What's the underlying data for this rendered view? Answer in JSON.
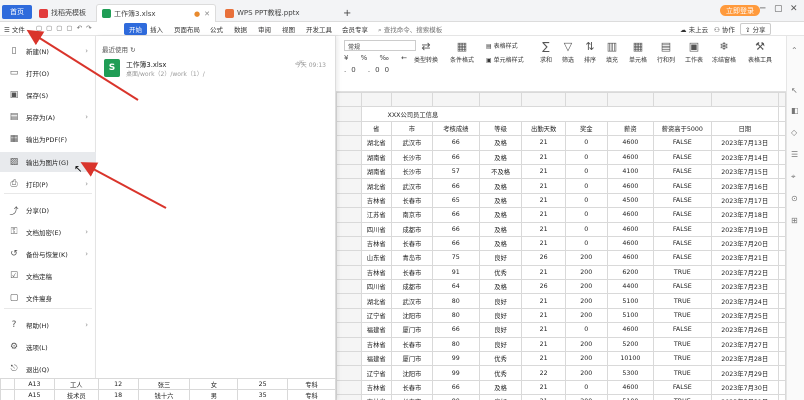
{
  "tabs": {
    "home": "首页",
    "template": "找稻壳模板",
    "xlsx": "工作簿3.xlsx",
    "pptx": "WPS PPT教程.pptx",
    "plus": "+"
  },
  "window": {
    "vip": "立即登录",
    "sync": "未上云",
    "collab": "协作",
    "share": "分享"
  },
  "ribbon": {
    "file": "文件",
    "start": "开始",
    "insert": "插入",
    "layout": "页面布局",
    "formula": "公式",
    "data": "数据",
    "review": "审阅",
    "view": "视图",
    "dev": "开发工具",
    "member": "会员专享",
    "search": "查找命令、搜索模板"
  },
  "toolbar": {
    "font_style": "常规",
    "type_convert": "类型转换",
    "cond_format": "条件格式",
    "table_style": "表格样式",
    "cell_style": "单元格样式",
    "sum": "求和",
    "filter": "筛选",
    "sort": "排序",
    "fill": "填充",
    "cell": "单元格",
    "rowcol": "行和列",
    "sheet": "工作表",
    "freeze": "冻结窗格",
    "table_tools": "表格工具"
  },
  "menu": {
    "items": [
      {
        "label": "新建(N)",
        "icon": "new-icon"
      },
      {
        "label": "打开(O)",
        "icon": "open-icon"
      },
      {
        "label": "保存(S)",
        "icon": "save-icon"
      },
      {
        "label": "另存为(A)",
        "icon": "save-as-icon"
      },
      {
        "label": "输出为PDF(F)",
        "icon": "pdf-icon"
      },
      {
        "label": "输出为图片(G)",
        "icon": "image-icon"
      },
      {
        "label": "打印(P)",
        "icon": "print-icon"
      },
      {
        "label": "分享(D)",
        "icon": "share-icon"
      },
      {
        "label": "文档加密(E)",
        "icon": "lock-icon"
      },
      {
        "label": "备份与恢复(K)",
        "icon": "backup-icon"
      },
      {
        "label": "文档定稿",
        "icon": "finalize-icon"
      },
      {
        "label": "文件瘦身",
        "icon": "slim-icon"
      },
      {
        "label": "帮助(H)",
        "icon": "help-icon"
      },
      {
        "label": "选项(L)",
        "icon": "gear-icon"
      },
      {
        "label": "退出(Q)",
        "icon": "exit-icon"
      }
    ]
  },
  "recent": {
    "title": "最近使用",
    "file_name": "工作簿3.xlsx",
    "file_path": "桌面/work（2）/work（1）/",
    "time": "今天 09:13",
    "file_badge": "S"
  },
  "sheet": {
    "title": "XXX公司员工信息",
    "headers": [
      "省",
      "市",
      "考核成绩",
      "等级",
      "出勤天数",
      "奖金",
      "薪资",
      "薪资高于5000",
      "日期"
    ],
    "rows": [
      [
        "湖北省",
        "武汉市",
        "66",
        "及格",
        "21",
        "0",
        "4600",
        "FALSE",
        "2023年7月13日"
      ],
      [
        "湖南省",
        "长沙市",
        "66",
        "及格",
        "21",
        "0",
        "4600",
        "FALSE",
        "2023年7月14日"
      ],
      [
        "湖南省",
        "长沙市",
        "57",
        "不及格",
        "21",
        "0",
        "4100",
        "FALSE",
        "2023年7月15日"
      ],
      [
        "湖北省",
        "武汉市",
        "66",
        "及格",
        "21",
        "0",
        "4600",
        "FALSE",
        "2023年7月16日"
      ],
      [
        "吉林省",
        "长春市",
        "65",
        "及格",
        "21",
        "0",
        "4500",
        "FALSE",
        "2023年7月17日"
      ],
      [
        "江苏省",
        "南京市",
        "66",
        "及格",
        "21",
        "0",
        "4600",
        "FALSE",
        "2023年7月18日"
      ],
      [
        "四川省",
        "成都市",
        "66",
        "及格",
        "21",
        "0",
        "4600",
        "FALSE",
        "2023年7月19日"
      ],
      [
        "吉林省",
        "长春市",
        "66",
        "及格",
        "21",
        "0",
        "4600",
        "FALSE",
        "2023年7月20日"
      ],
      [
        "山东省",
        "青岛市",
        "75",
        "良好",
        "26",
        "200",
        "4600",
        "FALSE",
        "2023年7月21日"
      ],
      [
        "吉林省",
        "长春市",
        "91",
        "优秀",
        "21",
        "200",
        "6200",
        "TRUE",
        "2023年7月22日"
      ],
      [
        "四川省",
        "成都市",
        "64",
        "及格",
        "26",
        "200",
        "4400",
        "FALSE",
        "2023年7月23日"
      ],
      [
        "湖北省",
        "武汉市",
        "80",
        "良好",
        "21",
        "200",
        "5100",
        "TRUE",
        "2023年7月24日"
      ],
      [
        "辽宁省",
        "沈阳市",
        "80",
        "良好",
        "21",
        "200",
        "5100",
        "TRUE",
        "2023年7月25日"
      ],
      [
        "福建省",
        "厦门市",
        "66",
        "良好",
        "21",
        "0",
        "4600",
        "FALSE",
        "2023年7月26日"
      ],
      [
        "吉林省",
        "长春市",
        "80",
        "良好",
        "21",
        "200",
        "5200",
        "TRUE",
        "2023年7月27日"
      ],
      [
        "福建省",
        "厦门市",
        "99",
        "优秀",
        "21",
        "200",
        "10100",
        "TRUE",
        "2023年7月28日"
      ],
      [
        "辽宁省",
        "沈阳市",
        "99",
        "优秀",
        "22",
        "200",
        "5300",
        "TRUE",
        "2023年7月29日"
      ],
      [
        "吉林省",
        "长春市",
        "66",
        "及格",
        "21",
        "0",
        "4600",
        "FALSE",
        "2023年7月30日"
      ],
      [
        "吉林省",
        "长春市",
        "80",
        "良好",
        "21",
        "200",
        "5100",
        "TRUE",
        "2023年7月31日"
      ]
    ]
  },
  "bottom_rows": [
    [
      "A13",
      "工人",
      "12",
      "张三",
      "女",
      "25",
      "专科"
    ],
    [
      "A15",
      "技术员",
      "18",
      "钱十六",
      "男",
      "35",
      "专科"
    ]
  ],
  "colors": {
    "accent": "#2f6bdc",
    "vip": "#ff9a3c",
    "xlsx": "#1f9d55",
    "arrow": "#d9342b"
  }
}
